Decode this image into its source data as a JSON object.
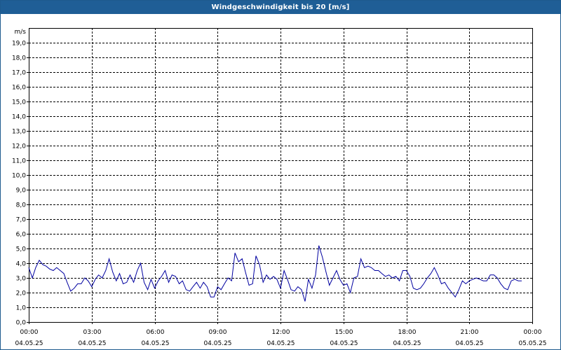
{
  "window": {
    "title": "Windgeschwindigkeit bis 20 [m/s]"
  },
  "chart_data": {
    "type": "line",
    "title": "Windgeschwindigkeit bis 20 [m/s]",
    "ylabel": "m/s",
    "xlabel": "",
    "ylim": [
      0,
      20
    ],
    "xlim": [
      0,
      24
    ],
    "grid": true,
    "y_ticks": [
      "0,0",
      "1,0",
      "2,0",
      "3,0",
      "4,0",
      "5,0",
      "6,0",
      "7,0",
      "8,0",
      "9,0",
      "10,0",
      "11,0",
      "12,0",
      "13,0",
      "14,0",
      "15,0",
      "16,0",
      "17,0",
      "18,0",
      "19,0"
    ],
    "x_ticks": [
      {
        "time": "00:00",
        "date": "04.05.25"
      },
      {
        "time": "03:00",
        "date": "04.05.25"
      },
      {
        "time": "06:00",
        "date": "04.05.25"
      },
      {
        "time": "09:00",
        "date": "04.05.25"
      },
      {
        "time": "12:00",
        "date": "04.05.25"
      },
      {
        "time": "15:00",
        "date": "04.05.25"
      },
      {
        "time": "18:00",
        "date": "04.05.25"
      },
      {
        "time": "21:00",
        "date": "04.05.25"
      },
      {
        "time": "00:00",
        "date": "05.05.25"
      }
    ],
    "colors": {
      "line": "#0000a0",
      "grid": "#000000"
    },
    "x_hours": [
      0,
      0.17,
      0.33,
      0.5,
      0.67,
      0.83,
      1,
      1.17,
      1.33,
      1.5,
      1.67,
      1.83,
      2,
      2.17,
      2.33,
      2.5,
      2.67,
      2.83,
      3,
      3.17,
      3.33,
      3.5,
      3.67,
      3.83,
      4,
      4.17,
      4.33,
      4.5,
      4.67,
      4.83,
      5,
      5.17,
      5.33,
      5.5,
      5.67,
      5.83,
      6,
      6.17,
      6.33,
      6.5,
      6.67,
      6.83,
      7,
      7.17,
      7.33,
      7.5,
      7.67,
      7.83,
      8,
      8.17,
      8.33,
      8.5,
      8.67,
      8.83,
      9,
      9.17,
      9.33,
      9.5,
      9.67,
      9.83,
      10,
      10.17,
      10.33,
      10.5,
      10.67,
      10.83,
      11,
      11.17,
      11.33,
      11.5,
      11.67,
      11.83,
      12,
      12.17,
      12.33,
      12.5,
      12.67,
      12.83,
      13,
      13.17,
      13.33,
      13.5,
      13.67,
      13.83,
      14,
      14.17,
      14.33,
      14.5,
      14.67,
      14.83,
      15,
      15.17,
      15.33,
      15.5,
      15.67,
      15.83,
      16,
      16.17,
      16.33,
      16.5,
      16.67,
      16.83,
      17,
      17.17,
      17.33,
      17.5,
      17.67,
      17.83,
      18,
      18.17,
      18.33,
      18.5,
      18.67,
      18.83,
      19,
      19.17,
      19.33,
      19.5,
      19.67,
      19.83,
      20,
      20.17,
      20.33,
      20.5,
      20.67,
      20.83,
      21,
      21.17,
      21.33,
      21.5,
      21.67,
      21.83,
      22,
      22.17,
      22.33,
      22.5,
      22.67,
      22.83,
      23,
      23.17,
      23.33,
      23.5,
      23.67,
      23.83
    ],
    "y_values": [
      3.7,
      3.0,
      3.7,
      4.2,
      3.9,
      3.8,
      3.6,
      3.5,
      3.7,
      3.5,
      3.3,
      2.7,
      2.1,
      2.3,
      2.6,
      2.6,
      3.0,
      2.8,
      2.4,
      2.9,
      3.2,
      3.0,
      3.5,
      4.3,
      3.4,
      2.8,
      3.3,
      2.6,
      2.7,
      3.2,
      2.7,
      3.5,
      4.0,
      2.7,
      2.2,
      2.9,
      2.3,
      2.8,
      3.1,
      3.5,
      2.7,
      3.2,
      3.1,
      2.6,
      2.8,
      2.2,
      2.1,
      2.4,
      2.7,
      2.3,
      2.7,
      2.4,
      1.7,
      1.7,
      2.4,
      2.2,
      2.6,
      3.0,
      2.8,
      4.7,
      4.1,
      4.3,
      3.4,
      2.5,
      2.6,
      4.5,
      3.9,
      2.7,
      3.2,
      2.9,
      3.1,
      2.9,
      2.3,
      3.5,
      2.9,
      2.2,
      2.1,
      2.4,
      2.2,
      1.4,
      2.9,
      2.3,
      3.2,
      5.2,
      4.4,
      3.4,
      2.5,
      3.0,
      3.5,
      2.9,
      2.5,
      2.6,
      2.0,
      3.0,
      3.1,
      4.3,
      3.7,
      3.8,
      3.7,
      3.5,
      3.5,
      3.3,
      3.1,
      3.2,
      3.0,
      3.1,
      2.8,
      3.5,
      3.5,
      3.1,
      2.3,
      2.2,
      2.3,
      2.6,
      3.0,
      3.3,
      3.7,
      3.2,
      2.6,
      2.7,
      2.3,
      2.0,
      1.7,
      2.2,
      2.8,
      2.6,
      2.8,
      2.9,
      3.0,
      2.9,
      2.8,
      2.8,
      3.2,
      3.2,
      3.0,
      2.6,
      2.3,
      2.2,
      2.8,
      2.9,
      2.8,
      2.8
    ]
  }
}
